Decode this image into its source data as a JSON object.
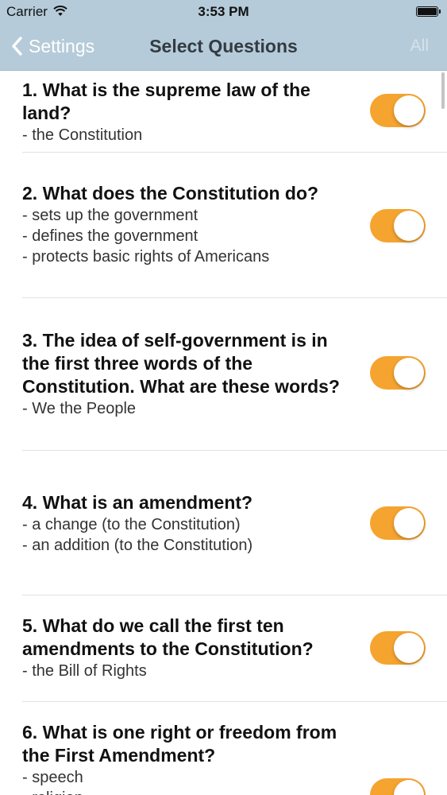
{
  "status_bar": {
    "carrier": "Carrier",
    "time": "3:53 PM",
    "wifi_icon": "wifi-icon",
    "battery_icon": "battery-icon"
  },
  "nav": {
    "back_label": "Settings",
    "title": "Select Questions",
    "right_label": "All"
  },
  "colors": {
    "nav_background": "#b5cbd9",
    "toggle_on": "#f5a42f"
  },
  "questions": [
    {
      "question": "1. What is the supreme law of the land?",
      "answers": [
        "- the Constitution"
      ],
      "enabled": true
    },
    {
      "question": "2. What does the Constitution do?",
      "answers": [
        "- sets up the government",
        "- defines the government",
        "- protects basic rights of Americans"
      ],
      "enabled": true
    },
    {
      "question": "3. The idea of self-government is in the first three words of the Constitution. What are these words?",
      "answers": [
        "- We the People"
      ],
      "enabled": true
    },
    {
      "question": "4. What is an amendment?",
      "answers": [
        "- a change (to the Constitution)",
        "- an addition (to the Constitution)"
      ],
      "enabled": true
    },
    {
      "question": "5. What do we call the first ten amendments to the Constitution?",
      "answers": [
        "- the Bill of Rights"
      ],
      "enabled": true
    },
    {
      "question": "6. What is one right or freedom from the First Amendment?",
      "answers": [
        "- speech",
        "- religion"
      ],
      "enabled": true
    }
  ]
}
